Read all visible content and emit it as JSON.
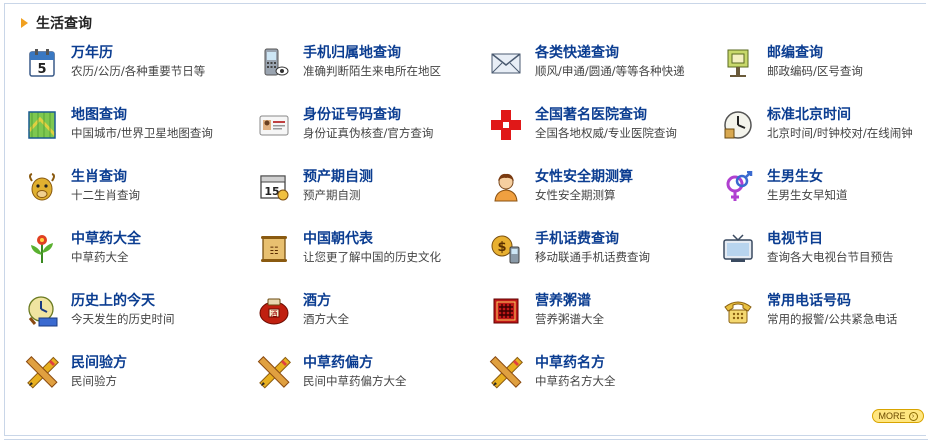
{
  "header": {
    "title": "生活查询"
  },
  "more_label": "MORE",
  "rows": [
    [
      {
        "title": "万年历",
        "desc": "农历/公历/各种重要节日等",
        "icon": "calendar-icon"
      },
      {
        "title": "手机归属地查询",
        "desc": "准确判断陌生来电所在地区",
        "icon": "mobile-phone-icon"
      },
      {
        "title": "各类快递查询",
        "desc": "顺风/申通/圆通/等等各种快递",
        "icon": "envelope-icon"
      },
      {
        "title": "邮编查询",
        "desc": "邮政编码/区号查询",
        "icon": "mailbox-icon"
      }
    ],
    [
      {
        "title": "地图查询",
        "desc": "中国城市/世界卫星地图查询",
        "icon": "map-icon"
      },
      {
        "title": "身份证号码查询",
        "desc": "身份证真伪核查/官方查询",
        "icon": "id-card-icon"
      },
      {
        "title": "全国著名医院查询",
        "desc": "全国各地权威/专业医院查询",
        "icon": "red-cross-icon"
      },
      {
        "title": "标准北京时间",
        "desc": "北京时间/时钟校对/在线闹钟",
        "icon": "clock-icon"
      }
    ],
    [
      {
        "title": "生肖查询",
        "desc": "十二生肖查询",
        "icon": "ox-icon"
      },
      {
        "title": "预产期自测",
        "desc": "预产期自测",
        "icon": "date-calendar-icon"
      },
      {
        "title": "女性安全期测算",
        "desc": "女性安全期测算",
        "icon": "woman-icon"
      },
      {
        "title": "生男生女",
        "desc": "生男生女早知道",
        "icon": "gender-icon"
      }
    ],
    [
      {
        "title": "中草药大全",
        "desc": "中草药大全",
        "icon": "herb-icon"
      },
      {
        "title": "中国朝代表",
        "desc": "让您更了解中国的历史文化",
        "icon": "scroll-icon"
      },
      {
        "title": "手机话费查询",
        "desc": "移动联通手机话费查询",
        "icon": "money-phone-icon"
      },
      {
        "title": "电视节目",
        "desc": "查询各大电视台节目预告",
        "icon": "tv-icon"
      }
    ],
    [
      {
        "title": "历史上的今天",
        "desc": "今天发生的历史时间",
        "icon": "history-icon"
      },
      {
        "title": "酒方",
        "desc": "酒方大全",
        "icon": "wine-jar-icon"
      },
      {
        "title": "营养粥谱",
        "desc": "营养粥谱大全",
        "icon": "porridge-icon"
      },
      {
        "title": "常用电话号码",
        "desc": "常用的报警/公共紧急电话",
        "icon": "telephone-icon"
      }
    ],
    [
      {
        "title": "民间验方",
        "desc": "民间验方",
        "icon": "pencil-ruler-icon"
      },
      {
        "title": "中草药偏方",
        "desc": "民间中草药偏方大全",
        "icon": "pencil-ruler-icon"
      },
      {
        "title": "中草药名方",
        "desc": "中草药名方大全",
        "icon": "pencil-ruler-icon"
      }
    ]
  ]
}
